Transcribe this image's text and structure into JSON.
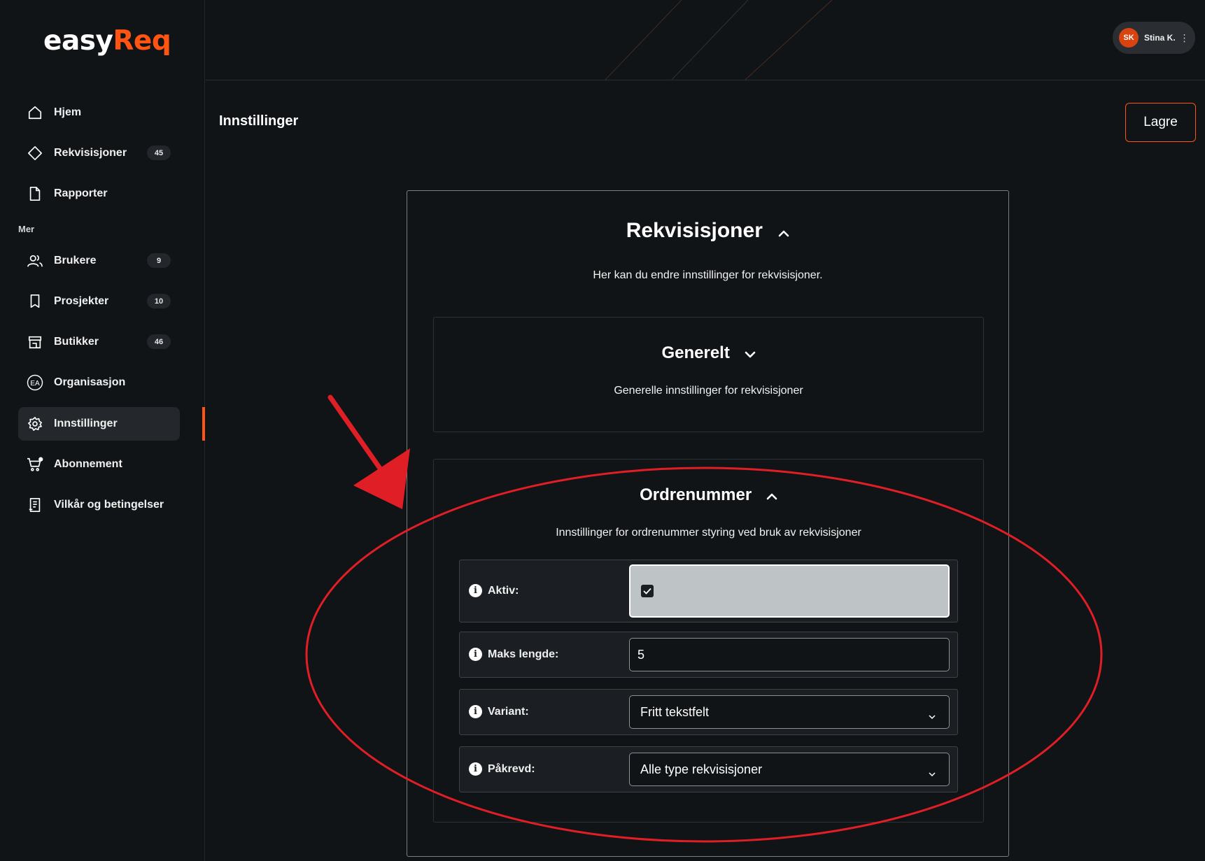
{
  "app": {
    "logo_part1": "easy",
    "logo_part2": "Req",
    "accent_color": "#ff5412"
  },
  "sidebar": {
    "section_label": "Mer",
    "items": [
      {
        "label": "Hjem",
        "icon": "home-icon"
      },
      {
        "label": "Rekvisisjoner",
        "icon": "diamond-icon",
        "badge": "45"
      },
      {
        "label": "Rapporter",
        "icon": "document-icon"
      },
      {
        "label": "Brukere",
        "icon": "users-icon",
        "badge": "9"
      },
      {
        "label": "Prosjekter",
        "icon": "bookmark-icon",
        "badge": "10"
      },
      {
        "label": "Butikker",
        "icon": "store-icon",
        "badge": "46"
      },
      {
        "label": "Organisasjon",
        "icon": "organization-icon",
        "icon_text": "EA"
      },
      {
        "label": "Innstillinger",
        "icon": "gear-icon",
        "active": true
      },
      {
        "label": "Abonnement",
        "icon": "cart-icon"
      },
      {
        "label": "Vilkår og betingelser",
        "icon": "terms-icon"
      }
    ]
  },
  "user": {
    "initials": "SK",
    "name": "Stina K."
  },
  "page": {
    "title": "Innstillinger",
    "save_label": "Lagre"
  },
  "settings": {
    "title": "Rekvisisjoner",
    "description": "Her kan du endre innstillinger for rekvisisjoner.",
    "general": {
      "title": "Generelt",
      "description": "Generelle innstillinger for rekvisisjoner"
    },
    "order_number": {
      "title": "Ordrenummer",
      "description": "Innstillinger for ordrenummer styring ved bruk av rekvisisjoner",
      "fields": {
        "active_label": "Aktiv:",
        "active_checked": true,
        "max_length_label": "Maks lengde:",
        "max_length_value": "5",
        "variant_label": "Variant:",
        "variant_value": "Fritt tekstfelt",
        "required_label": "Påkrevd:",
        "required_value": "Alle type rekvisisjoner"
      }
    }
  },
  "annotation": {
    "color": "#e01e25",
    "shapes": [
      "arrow",
      "ellipse"
    ]
  }
}
